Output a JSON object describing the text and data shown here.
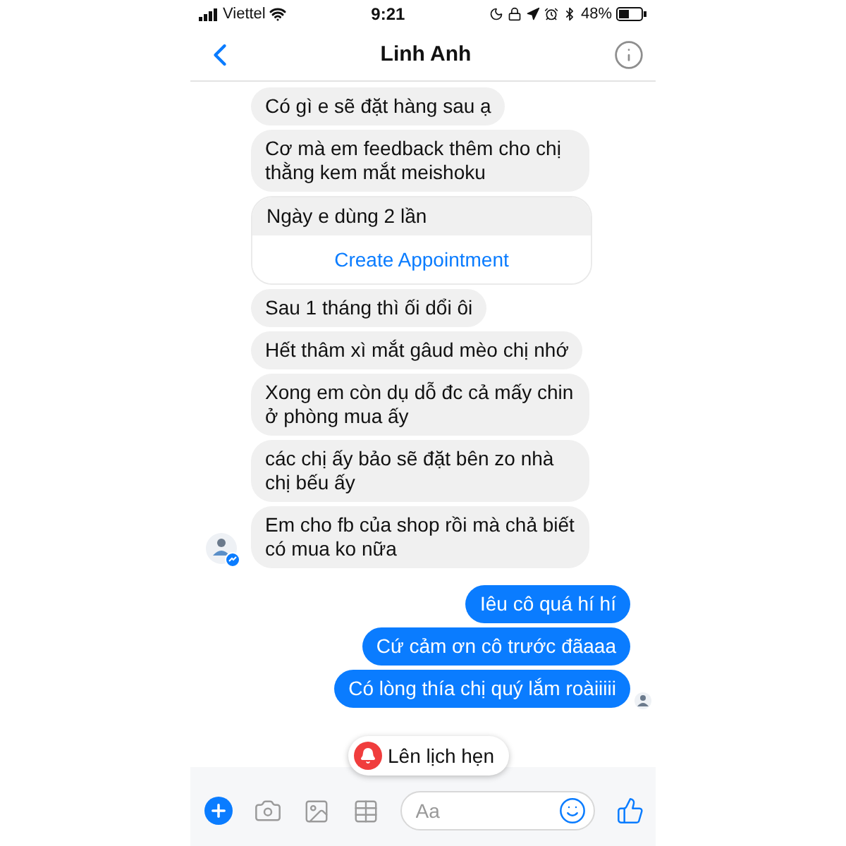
{
  "status_bar": {
    "carrier": "Viettel",
    "time": "9:21",
    "battery": "48%"
  },
  "header": {
    "title": "Linh Anh"
  },
  "messages": [
    {
      "kind": "incoming",
      "text": "Có gì e sẽ đặt hàng sau ạ"
    },
    {
      "kind": "incoming",
      "text": "Cơ mà em feedback thêm cho chị thằng kem mắt meishoku"
    },
    {
      "kind": "incoming",
      "text": "Ngày e dùng 2 lần",
      "action": "Create Appointment"
    },
    {
      "kind": "incoming",
      "text": "Sau 1 tháng thì ối dổi ôi"
    },
    {
      "kind": "incoming",
      "text": "Hết thâm xì mắt gâud mèo chị nhớ"
    },
    {
      "kind": "incoming",
      "text": "Xong em còn dụ dỗ đc cả mấy chin ở phòng mua ấy"
    },
    {
      "kind": "incoming",
      "text": "các chị ấy bảo  sẽ đặt bên zo nhà chị bếu ấy"
    },
    {
      "kind": "incoming",
      "text": "Em cho fb của shop rồi mà chả biết có mua ko nữa"
    },
    {
      "kind": "outgoing",
      "text": "Iêu cô quá hí hí"
    },
    {
      "kind": "outgoing",
      "text": "Cứ cảm ơn cô trước đãaaa"
    },
    {
      "kind": "outgoing",
      "text": "Có lòng thía chị quý lắm roàiiiii"
    }
  ],
  "reminder": {
    "label": "Lên lịch hẹn"
  },
  "composer": {
    "placeholder": "Aa"
  }
}
